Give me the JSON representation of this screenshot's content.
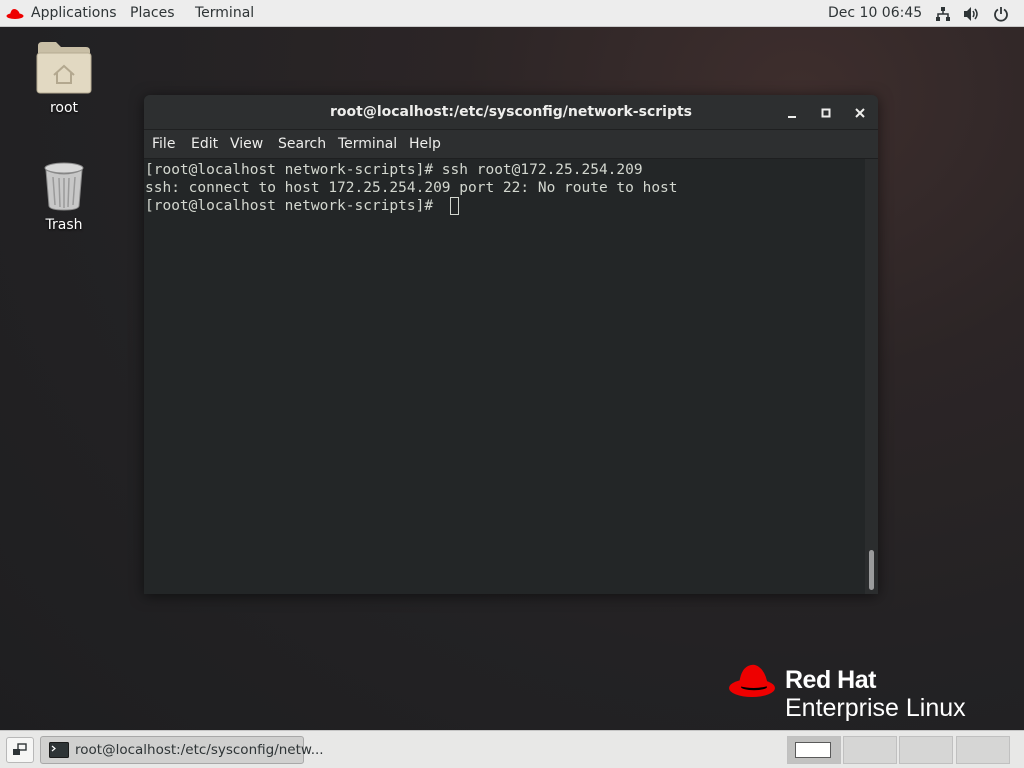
{
  "top_panel": {
    "applications_label": "Applications",
    "places_label": "Places",
    "terminal_label": "Terminal",
    "clock": "Dec 10  06:45"
  },
  "desktop": {
    "icons": [
      {
        "label": "root",
        "icon": "home-folder-icon"
      },
      {
        "label": "Trash",
        "icon": "trash-icon"
      }
    ]
  },
  "terminal_window": {
    "title": "root@localhost:/etc/sysconfig/network-scripts",
    "menu": [
      "File",
      "Edit",
      "View",
      "Search",
      "Terminal",
      "Help"
    ],
    "lines": [
      "[root@localhost network-scripts]# ssh root@172.25.254.209",
      "ssh: connect to host 172.25.254.209 port 22: No route to host",
      "[root@localhost network-scripts]# "
    ]
  },
  "branding": {
    "name": "Red Hat",
    "product": "Enterprise Linux",
    "color": "#ee0000"
  },
  "taskbar": {
    "task_label": "root@localhost:/etc/sysconfig/netw...",
    "workspaces": 4,
    "active_workspace": 1
  }
}
